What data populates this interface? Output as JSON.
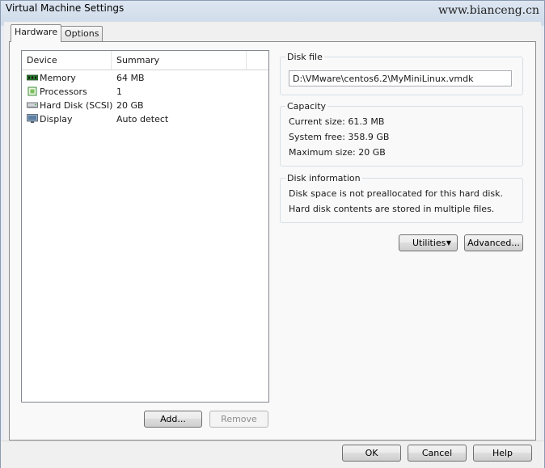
{
  "window": {
    "title": "Virtual Machine Settings",
    "watermark": "www.bianceng.cn"
  },
  "tabs": [
    {
      "label": "Hardware",
      "selected": true
    },
    {
      "label": "Options",
      "selected": false
    }
  ],
  "device_list": {
    "columns": [
      "Device",
      "Summary"
    ],
    "rows": [
      {
        "device": "Memory",
        "summary": "64 MB",
        "icon": "memory-icon"
      },
      {
        "device": "Processors",
        "summary": "1",
        "icon": "processor-icon"
      },
      {
        "device": "Hard Disk (SCSI)",
        "summary": "20 GB",
        "icon": "hard-disk-icon"
      },
      {
        "device": "Display",
        "summary": "Auto detect",
        "icon": "display-icon"
      }
    ],
    "add_label": "Add...",
    "remove_label": "Remove"
  },
  "disk_file": {
    "title": "Disk file",
    "value": "D:\\VMware\\centos6.2\\MyMiniLinux.vmdk"
  },
  "capacity": {
    "title": "Capacity",
    "current": "Current size: 61.3 MB",
    "free": "System free: 358.9 GB",
    "maximum": "Maximum size:  20 GB"
  },
  "disk_info": {
    "title": "Disk information",
    "line1": "Disk space is not preallocated for this hard disk.",
    "line2": "Hard disk contents are stored in multiple files."
  },
  "actions": {
    "utilities_label": "Utilities",
    "advanced_label": "Advanced..."
  },
  "footer": {
    "ok_label": "OK",
    "cancel_label": "Cancel",
    "help_label": "Help"
  }
}
